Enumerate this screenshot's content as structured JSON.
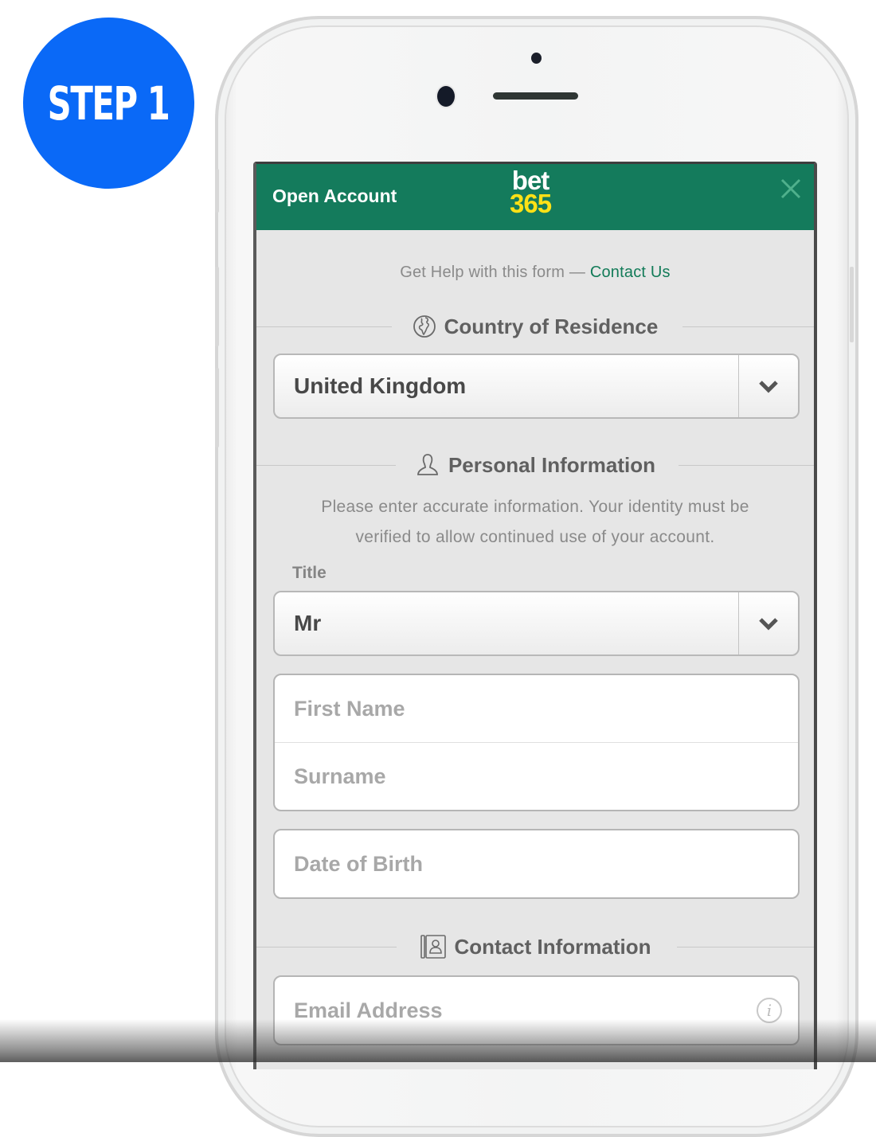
{
  "badge": {
    "label": "STEP 1",
    "color": "#0a69f7"
  },
  "header": {
    "title": "Open Account",
    "logo_top": "bet",
    "logo_bottom": "365",
    "close_icon": "close-icon",
    "brand_color": "#147b5c"
  },
  "help": {
    "text": "Get Help with this form —",
    "link": "Contact Us"
  },
  "sections": {
    "country": {
      "title": "Country of Residence",
      "icon": "globe-icon"
    },
    "personal": {
      "title": "Personal Information",
      "icon": "person-icon",
      "description_line1": "Please enter accurate information. Your identity must be",
      "description_line2": "verified to allow continued use of your account."
    },
    "contact": {
      "title": "Contact Information",
      "icon": "contact-book-icon"
    }
  },
  "fields": {
    "country": {
      "value": "United Kingdom"
    },
    "title": {
      "label": "Title",
      "value": "Mr"
    },
    "first_name": {
      "placeholder": "First Name"
    },
    "surname": {
      "placeholder": "Surname"
    },
    "dob": {
      "placeholder": "Date of Birth"
    },
    "email": {
      "placeholder": "Email Address",
      "info_icon": "i"
    }
  }
}
